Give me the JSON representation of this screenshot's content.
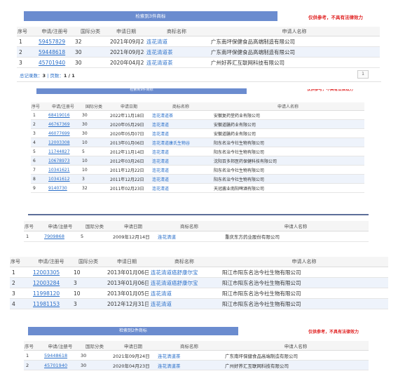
{
  "headers": [
    "序号",
    "申请/注册号",
    "国际分类",
    "申请日期",
    "商标名称",
    "申请人名称"
  ],
  "panel1": {
    "bar": "检索到3件商标",
    "warning": "仅供参考，不具有法律效力",
    "rows": [
      {
        "seq": "1",
        "num": "59457829",
        "cls": "32",
        "date": "2021年09月24日",
        "name": "连花清道",
        "applicant": "广东南坪保健食品高端制造有限公司"
      },
      {
        "seq": "2",
        "num": "59448618",
        "cls": "30",
        "date": "2021年09月24日",
        "name": "连花清道茶",
        "applicant": "广东南坪保健食品高端制造有限公司"
      },
      {
        "seq": "3",
        "num": "45701940",
        "cls": "30",
        "date": "2020年04月23日",
        "name": "连花清道茶",
        "applicant": "广州好荞汇互联网科技有限公司"
      }
    ],
    "pager_label": "总记录数：",
    "pager_total": "3",
    "pager_sep": " | 页数：",
    "pager_pages": "1 / 1",
    "page_btn": "1"
  },
  "panel2": {
    "bar": "检索到9件商标",
    "warning": "仅供参考，不具有法律效力",
    "rows": [
      {
        "seq": "1",
        "num": "68419016",
        "cls": "30",
        "date": "2022年11月18日",
        "name": "连花清道茶",
        "applicant": "安徽复药堂药业有限公司"
      },
      {
        "seq": "2",
        "num": "46767369",
        "cls": "30",
        "date": "2020年05月29日",
        "name": "连花清道",
        "applicant": "安徽道膳药业有限公司"
      },
      {
        "seq": "3",
        "num": "46077699",
        "cls": "30",
        "date": "2020年05月07日",
        "name": "连花清道",
        "applicant": "安徽道膳药业有限公司"
      },
      {
        "seq": "4",
        "num": "12003308",
        "cls": "10",
        "date": "2013年01月06日",
        "name": "连花清道康氏生物谷",
        "applicant": "阳东名治今社生物有限公司"
      },
      {
        "seq": "5",
        "num": "11744827",
        "cls": "5",
        "date": "2012年11月14日",
        "name": "连花清道",
        "applicant": "阳东名治今社生物有限公司"
      },
      {
        "seq": "6",
        "num": "10678973",
        "cls": "10",
        "date": "2012年03月26日",
        "name": "连花清道",
        "applicant": "沈阳百多邦医药保健科技有限公司"
      },
      {
        "seq": "7",
        "num": "10341621",
        "cls": "10",
        "date": "2011年12月22日",
        "name": "连花清道",
        "applicant": "阳东名治今社生物有限公司"
      },
      {
        "seq": "8",
        "num": "10341612",
        "cls": "3",
        "date": "2011年12月22日",
        "name": "连花清道",
        "applicant": "阳东名治今社生物有限公司"
      },
      {
        "seq": "9",
        "num": "9140730",
        "cls": "32",
        "date": "2011年02月23日",
        "name": "连花清道",
        "applicant": "天冠酱业南阳啤酒有限公司"
      }
    ]
  },
  "panel3": {
    "rows": [
      {
        "seq": "1",
        "num": "7909868",
        "cls": "5",
        "date": "2009年12月14日",
        "name": "连花清道",
        "applicant": "重庆东方药业股份有限公司"
      }
    ]
  },
  "panel4": {
    "rows": [
      {
        "seq": "1",
        "num": "12003305",
        "cls": "10",
        "date": "2013年01月06日",
        "name": "连花清道癌舒康尔宝",
        "applicant": "阳江市阳东名治今社生物有限公司"
      },
      {
        "seq": "2",
        "num": "12003284",
        "cls": "3",
        "date": "2013年01月06日",
        "name": "连花清道癌舒康尔宝",
        "applicant": "阳江市阳东名治今社生物有限公司"
      },
      {
        "seq": "3",
        "num": "11998120",
        "cls": "10",
        "date": "2013年01月05日",
        "name": "连花清道",
        "applicant": "阳江市阳东名治今社生物有限公司"
      },
      {
        "seq": "4",
        "num": "11981153",
        "cls": "3",
        "date": "2012年12月31日",
        "name": "连花清道",
        "applicant": "阳江市阳东名治今社生物有限公司"
      }
    ]
  },
  "panel5": {
    "bar": "检索到2件商标",
    "warning": "仅供参考，不具有法律效力",
    "rows": [
      {
        "seq": "1",
        "num": "59448618",
        "cls": "30",
        "date": "2021年09月24日",
        "name": "连花清道茶",
        "applicant": "广东南坪保健食品高端制造有限公司"
      },
      {
        "seq": "2",
        "num": "45701940",
        "cls": "30",
        "date": "2020年04月23日",
        "name": "连花清道茶",
        "applicant": "广州好荞汇互联网科技有限公司"
      }
    ]
  }
}
